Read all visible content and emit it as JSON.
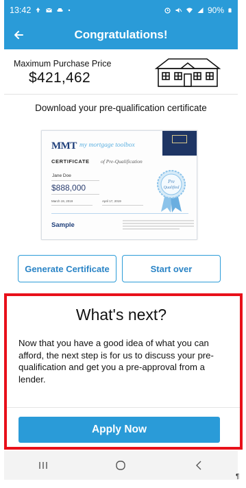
{
  "status_bar": {
    "time": "13:42",
    "battery": "90%",
    "left_icons": [
      "upload-icon",
      "mail-icon",
      "car-icon",
      "dot-icon"
    ],
    "right_icons": [
      "alarm-icon",
      "mute-icon",
      "wifi-icon",
      "signal-icon",
      "battery-icon"
    ]
  },
  "app_bar": {
    "title": "Congratulations!",
    "back_icon": "arrow-left-icon"
  },
  "summary": {
    "label": "Maximum Purchase Price",
    "value": "$421,462",
    "illustration_icon": "house-icon"
  },
  "certificate_section": {
    "title": "Download your pre-qualification certificate",
    "preview": {
      "logo": "MMT",
      "tagline": "my mortgage toolbox",
      "heading": "CERTIFICATE",
      "heading_suffix": "of Pre-Qualification",
      "name": "Jane Doe",
      "amount": "$888,000",
      "date_issued": "March 19, 2019",
      "date_expires": "April 17, 2019",
      "watermark": "Sample",
      "seal_text": "Pre Qualified"
    }
  },
  "actions": {
    "generate_label": "Generate Certificate",
    "start_over_label": "Start over"
  },
  "whats_next": {
    "title": "What's next?",
    "body": "Now that you have a good idea of what you can afford, the next step is for us to discuss your pre-qualification and get you a pre-approval from a lender.",
    "button_label": "Apply Now",
    "highlight_color": "#e8101a"
  },
  "nav_bar": {
    "items": [
      "recent-apps-icon",
      "home-icon",
      "back-icon"
    ]
  },
  "end_mark": "¶",
  "colors": {
    "primary": "#2a9bd8",
    "dark_navy": "#1e3564"
  }
}
